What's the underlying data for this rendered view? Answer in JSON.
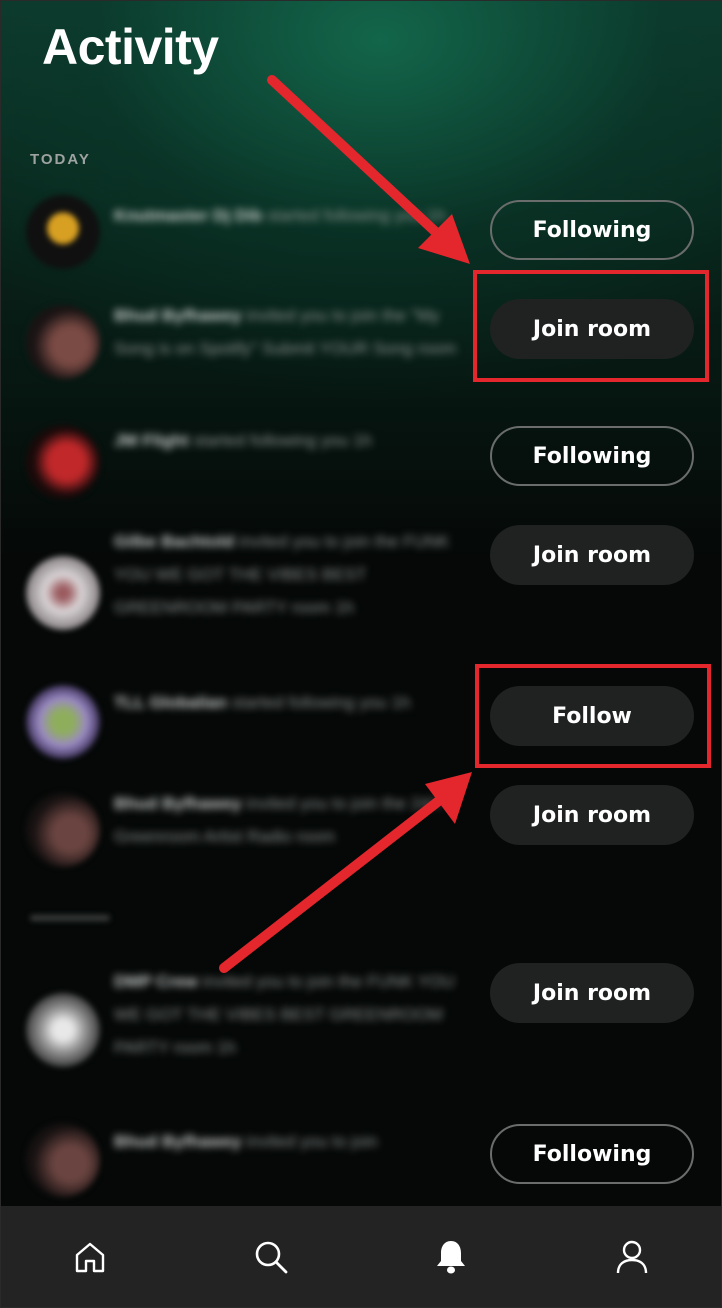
{
  "header": {
    "title": "Activity"
  },
  "section": {
    "today_label": "TODAY"
  },
  "activity": [
    {
      "name": "Knutmaster Dj Dib",
      "text": "started following you",
      "time": "1h",
      "button": "Following",
      "button_style": "outline",
      "avatar_color": "#d8a022"
    },
    {
      "name": "Bhud Byfhawey",
      "text": "invited you to join the \"My Song is on Spotify\" Submit YOUR Song room",
      "time": "",
      "button": "Join room",
      "button_style": "filled",
      "avatar_color": "#5a3a34"
    },
    {
      "name": "JM Flight",
      "text": "started following you",
      "time": "1h",
      "button": "Following",
      "button_style": "outline",
      "avatar_color": "#c0282a"
    },
    {
      "name": "Gilbe Bachtold",
      "text": "invited you to join the FUNK YOU WE GOT THE VIBES BEST GREENROOM PARTY room",
      "time": "1h",
      "button": "Join room",
      "button_style": "filled",
      "avatar_color": "#c9c4c6"
    },
    {
      "name": "TLL Globalian",
      "text": "started following you",
      "time": "1h",
      "button": "Follow",
      "button_style": "filled",
      "avatar_color": "#9b8ac4"
    },
    {
      "name": "Bhud Byfhawey",
      "text": "invited you to join the 24/7 Greenroom Artist Radio room",
      "time": "",
      "button": "Join room",
      "button_style": "filled",
      "avatar_color": "#5a3a34"
    },
    {
      "name": "DMP Crew",
      "text": "invited you to join the FUNK YOU WE GOT THE VIBES BEST GREENROOM PARTY room",
      "time": "1h",
      "button": "Join room",
      "button_style": "filled",
      "avatar_color": "#bdbdbd"
    },
    {
      "name": "Bhud Byfhawey",
      "text": "invited you to join",
      "time": "",
      "button": "Following",
      "button_style": "outline",
      "avatar_color": "#5a3a34"
    }
  ],
  "nav": [
    {
      "icon": "home-icon"
    },
    {
      "icon": "search-icon"
    },
    {
      "icon": "bell-icon",
      "active": true
    },
    {
      "icon": "profile-icon"
    }
  ],
  "colors": {
    "accent_annotation": "#e4262d",
    "background": "#050807",
    "nav_bg": "#232323"
  }
}
